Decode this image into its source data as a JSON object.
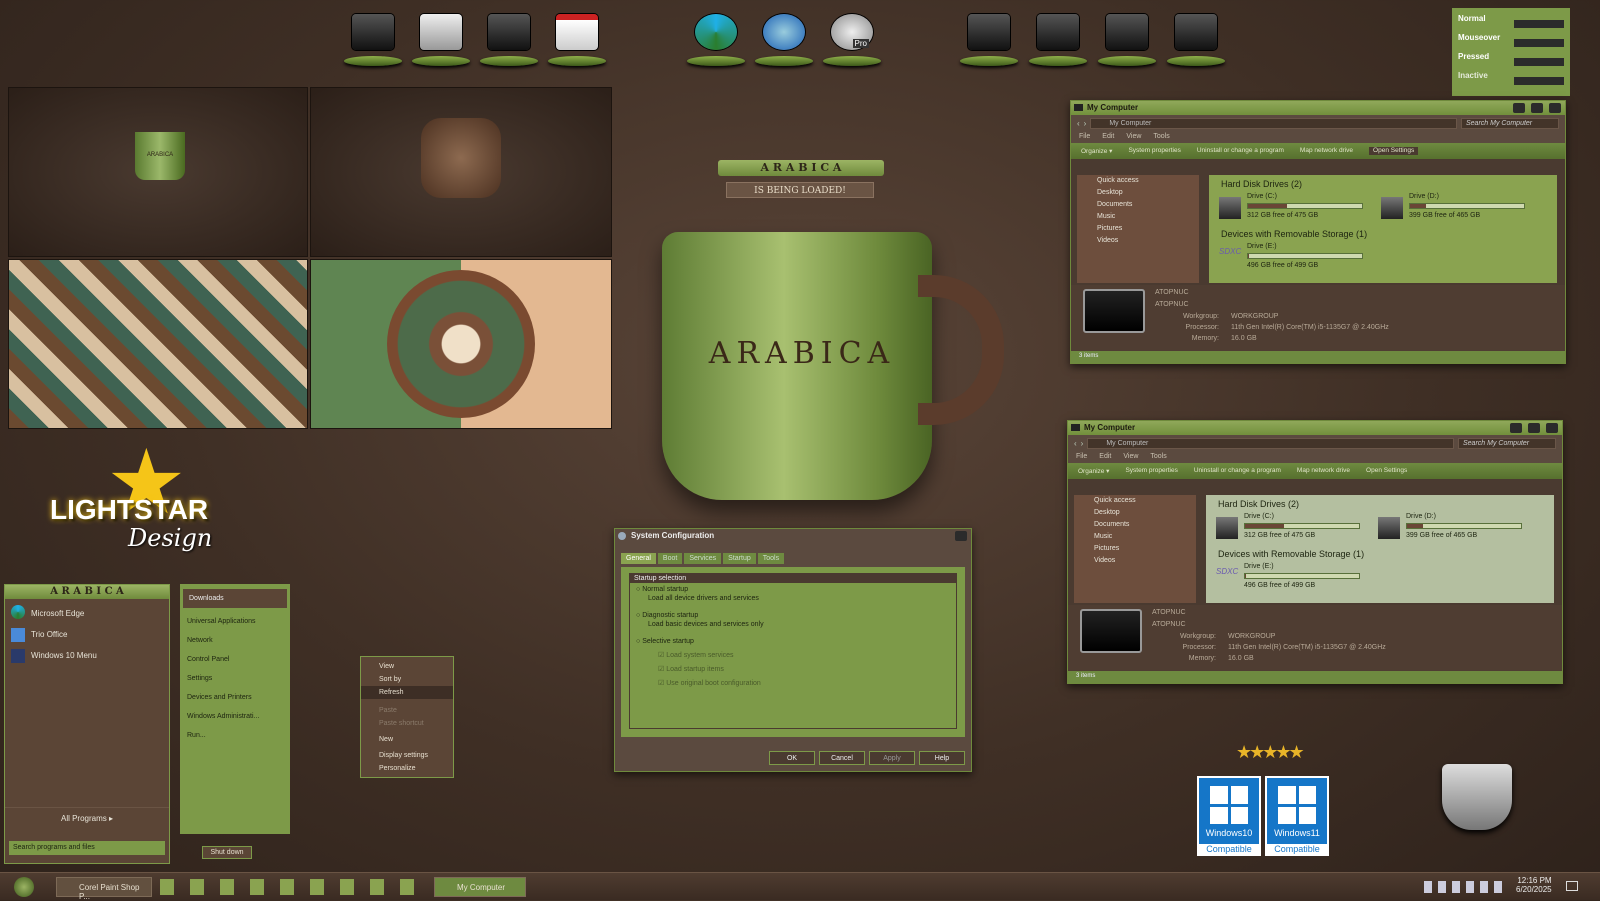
{
  "desktop_icons": {
    "group1": [
      "monitor-icon",
      "document-icon",
      "satellite-icon",
      "calendar-check-icon"
    ],
    "group2": [
      "edge-icon",
      "thunderbird-icon",
      "pro-icon"
    ],
    "group3": [
      "drive-icon",
      "drive-icon",
      "drive-icon",
      "drive-icon"
    ]
  },
  "pro_badge": "Pro",
  "states": {
    "normal": "Normal",
    "mouseover": "Mouseover",
    "pressed": "Pressed",
    "inactive": "Inactive"
  },
  "previews": {
    "mug_label": "ARABICA"
  },
  "logo": {
    "name": "LIGHTSTAR",
    "sub": "Design"
  },
  "splash": {
    "brand": "A R A B I C A",
    "loading": "IS BEING LOADED!",
    "mug_text": "ARABICA"
  },
  "explorer_top": {
    "title": "My Computer",
    "path": "My Computer",
    "search": "Search My Computer",
    "menu": [
      "File",
      "Edit",
      "View",
      "Tools"
    ],
    "commands": [
      "Organize ▾",
      "System properties",
      "Uninstall or change a program",
      "Map network drive",
      "Open Settings"
    ],
    "nav": [
      "Quick access",
      "Desktop",
      "Documents",
      "Music",
      "Pictures",
      "Videos"
    ],
    "group1": "Hard Disk Drives (2)",
    "group2": "Devices with Removable Storage (1)",
    "drive_c": {
      "name": "Drive (C:)",
      "free": "312 GB free of 475 GB",
      "used": 0.34
    },
    "drive_d": {
      "name": "Drive (D:)",
      "free": "399 GB free of 465 GB",
      "used": 0.14
    },
    "drive_e": {
      "name": "Drive (E:)",
      "free": "496 GB free of 499 GB",
      "used": 0.01
    },
    "sdxc": "SDXC",
    "pc_name": "ATOPNUC",
    "pc_name2": "ATOPNUC",
    "workgroup_label": "Workgroup:",
    "workgroup": "WORKGROUP",
    "processor_label": "Processor:",
    "processor": "11th Gen Intel(R) Core(TM) i5-1135G7 @ 2.40GHz",
    "memory_label": "Memory:",
    "memory": "16.0 GB",
    "status": "3 items"
  },
  "sysconfig": {
    "title": "System Configuration",
    "tabs": [
      "General",
      "Boot",
      "Services",
      "Startup",
      "Tools"
    ],
    "group": "Startup selection",
    "normal": "Normal startup",
    "normal_desc": "Load all device drivers and services",
    "diag": "Diagnostic startup",
    "diag_desc": "Load basic devices and services only",
    "selective": "Selective startup",
    "opts": [
      "Load system services",
      "Load startup items",
      "Use original boot configuration"
    ],
    "buttons": [
      "OK",
      "Cancel",
      "Apply",
      "Help"
    ]
  },
  "context_menu": [
    "View",
    "Sort by",
    "Refresh",
    "Paste",
    "Paste shortcut",
    "New",
    "Display settings",
    "Personalize"
  ],
  "start_menu": {
    "brand": "A R A B I C A",
    "pinned": [
      "Microsoft Edge",
      "Trio Office",
      "Windows 10 Menu"
    ],
    "all_programs": "All Programs ▸",
    "search": "Search programs and files",
    "right": [
      "Downloads",
      "Universal Applications",
      "Network",
      "Control Panel",
      "Settings",
      "Devices and Printers",
      "Windows Administrati...",
      "Run..."
    ],
    "shutdown": "Shut down"
  },
  "badges": {
    "win10": "Windows10",
    "win11": "Windows11",
    "compat": "Compatible"
  },
  "taskbar": {
    "app1": "Corel Paint Shop P...",
    "app2": "My Computer",
    "time": "12:16 PM",
    "date": "6/20/2025"
  },
  "colors": {
    "green": "#7d9a48",
    "brown": "#4a3a30",
    "accent": "#c9d98c"
  }
}
